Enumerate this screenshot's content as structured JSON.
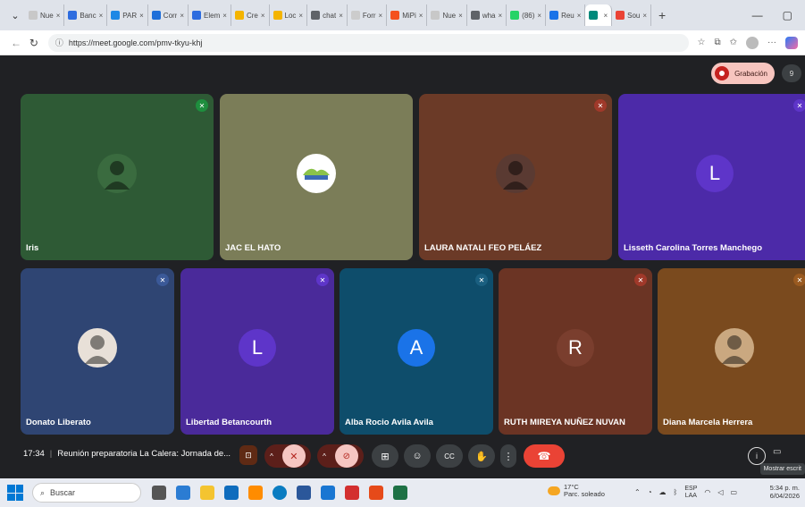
{
  "browser": {
    "tabs": [
      {
        "label": "Nue",
        "color": "#c8c8c8"
      },
      {
        "label": "Banc",
        "color": "#2d6cdf"
      },
      {
        "label": "PAR",
        "color": "#1e88e5"
      },
      {
        "label": "Corr",
        "color": "#1e6fd9"
      },
      {
        "label": "Elem",
        "color": "#2d6cdf"
      },
      {
        "label": "Cre",
        "color": "#f4b400"
      },
      {
        "label": "Loc",
        "color": "#f4b400"
      },
      {
        "label": "chat",
        "color": "#5f6368"
      },
      {
        "label": "Forr",
        "color": "#cccccc"
      },
      {
        "label": "MiPi",
        "color": "#f4511e"
      },
      {
        "label": "Nue",
        "color": "#c8c8c8"
      },
      {
        "label": "wha",
        "color": "#5f6368"
      },
      {
        "label": "(86)",
        "color": "#25d366"
      },
      {
        "label": "Reu",
        "color": "#1a73e8"
      },
      {
        "label": "",
        "color": "#00897b",
        "active": true
      },
      {
        "label": "Sou",
        "color": "#ea4335"
      }
    ],
    "url": "https://meet.google.com/pmv-tkyu-khj"
  },
  "meet": {
    "recording_label": "Grabación",
    "participant_count": "9",
    "tiles": [
      {
        "name": "Iris",
        "bg": "#2e5a35",
        "avatar_type": "photo",
        "avatar_color": "#3a6b3f",
        "mic_color": "#1e8e3e"
      },
      {
        "name": "JAC EL HATO",
        "bg": "#7b7d58",
        "avatar_type": "logo",
        "avatar_color": "#ffffff",
        "mic_color": ""
      },
      {
        "name": "LAURA NATALI FEO PELÁEZ",
        "bg": "#6b3a27",
        "avatar_type": "photo",
        "avatar_color": "#5a3a32",
        "mic_color": "#a0392a"
      },
      {
        "name": "Lisseth Carolina Torres Manchego",
        "bg": "#4c2aa8",
        "avatar_type": "letter",
        "avatar_letter": "L",
        "avatar_color": "#5e35c9",
        "mic_color": "#5e35c9"
      },
      {
        "name": "Donato Liberato",
        "bg": "#2f4573",
        "avatar_type": "photo",
        "avatar_color": "#e8e0d8",
        "mic_color": "#3b5998"
      },
      {
        "name": "Libertad Betancourth",
        "bg": "#4a2a9a",
        "avatar_type": "letter",
        "avatar_letter": "L",
        "avatar_color": "#5e35c9",
        "mic_color": "#5e35c9"
      },
      {
        "name": "Alba Rocio Avila Avila",
        "bg": "#0e4d6b",
        "avatar_type": "letter",
        "avatar_letter": "A",
        "avatar_color": "#1a73e8",
        "mic_color": "#1a5f80"
      },
      {
        "name": "RUTH MIREYA NUÑEZ NUVAN",
        "bg": "#6b3424",
        "avatar_type": "letter",
        "avatar_letter": "R",
        "avatar_color": "#7a3e2e",
        "mic_color": "#a0392a"
      },
      {
        "name": "Diana Marcela Herrera",
        "bg": "#7a4a1e",
        "avatar_type": "photo",
        "avatar_color": "#caa880",
        "mic_color": "#9a5a20"
      }
    ],
    "time": "17:34",
    "meeting_title": "Reunión preparatoria La Calera: Jornada de...",
    "tooltip": "Mostrar escrit"
  },
  "taskbar": {
    "search_placeholder": "Buscar",
    "weather_temp": "17°C",
    "weather_desc": "Parc. soleado",
    "lang_top": "ESP",
    "lang_bottom": "LAA",
    "time": "5:34 p. m.",
    "date": "6/04/2026"
  }
}
